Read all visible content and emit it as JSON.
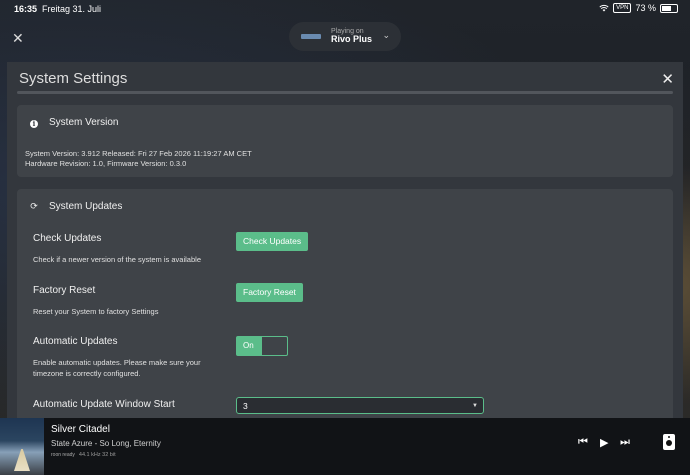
{
  "status_bar": {
    "time": "16:35",
    "date": "Freitag 31. Juli",
    "vpn": "VPN",
    "battery": "73 %",
    "battery_level": 0.73
  },
  "playing_on": {
    "label": "Playing on",
    "device": "Rivo Plus"
  },
  "dialog": {
    "title": "System Settings",
    "system_version": {
      "heading": "System Version",
      "line1": "System Version: 3.912 Released: Fri 27 Feb 2026 11:19:27 AM CET",
      "line2": "Hardware Revision: 1.0, Firmware Version: 0.3.0"
    },
    "system_updates": {
      "heading": "System Updates",
      "check": {
        "title": "Check Updates",
        "desc": "Check if a newer version of the system is available",
        "button": "Check Updates"
      },
      "reset": {
        "title": "Factory Reset",
        "desc": "Reset your System to factory Settings",
        "button": "Factory Reset"
      },
      "auto": {
        "title": "Automatic Updates",
        "desc": "Enable automatic updates. Please make sure your timezone is correctly configured.",
        "toggle": "On"
      },
      "window": {
        "title": "Automatic Update Window Start",
        "value": "3"
      }
    }
  },
  "player": {
    "track": "Silver Citadel",
    "artist": "State Azure - So Long, Eternity",
    "badge": "roon ready",
    "format": "44.1 kHz 32 bit"
  },
  "colors": {
    "accent": "#5bbd8a",
    "card": "#3f4348",
    "dialog": "#33373d"
  }
}
